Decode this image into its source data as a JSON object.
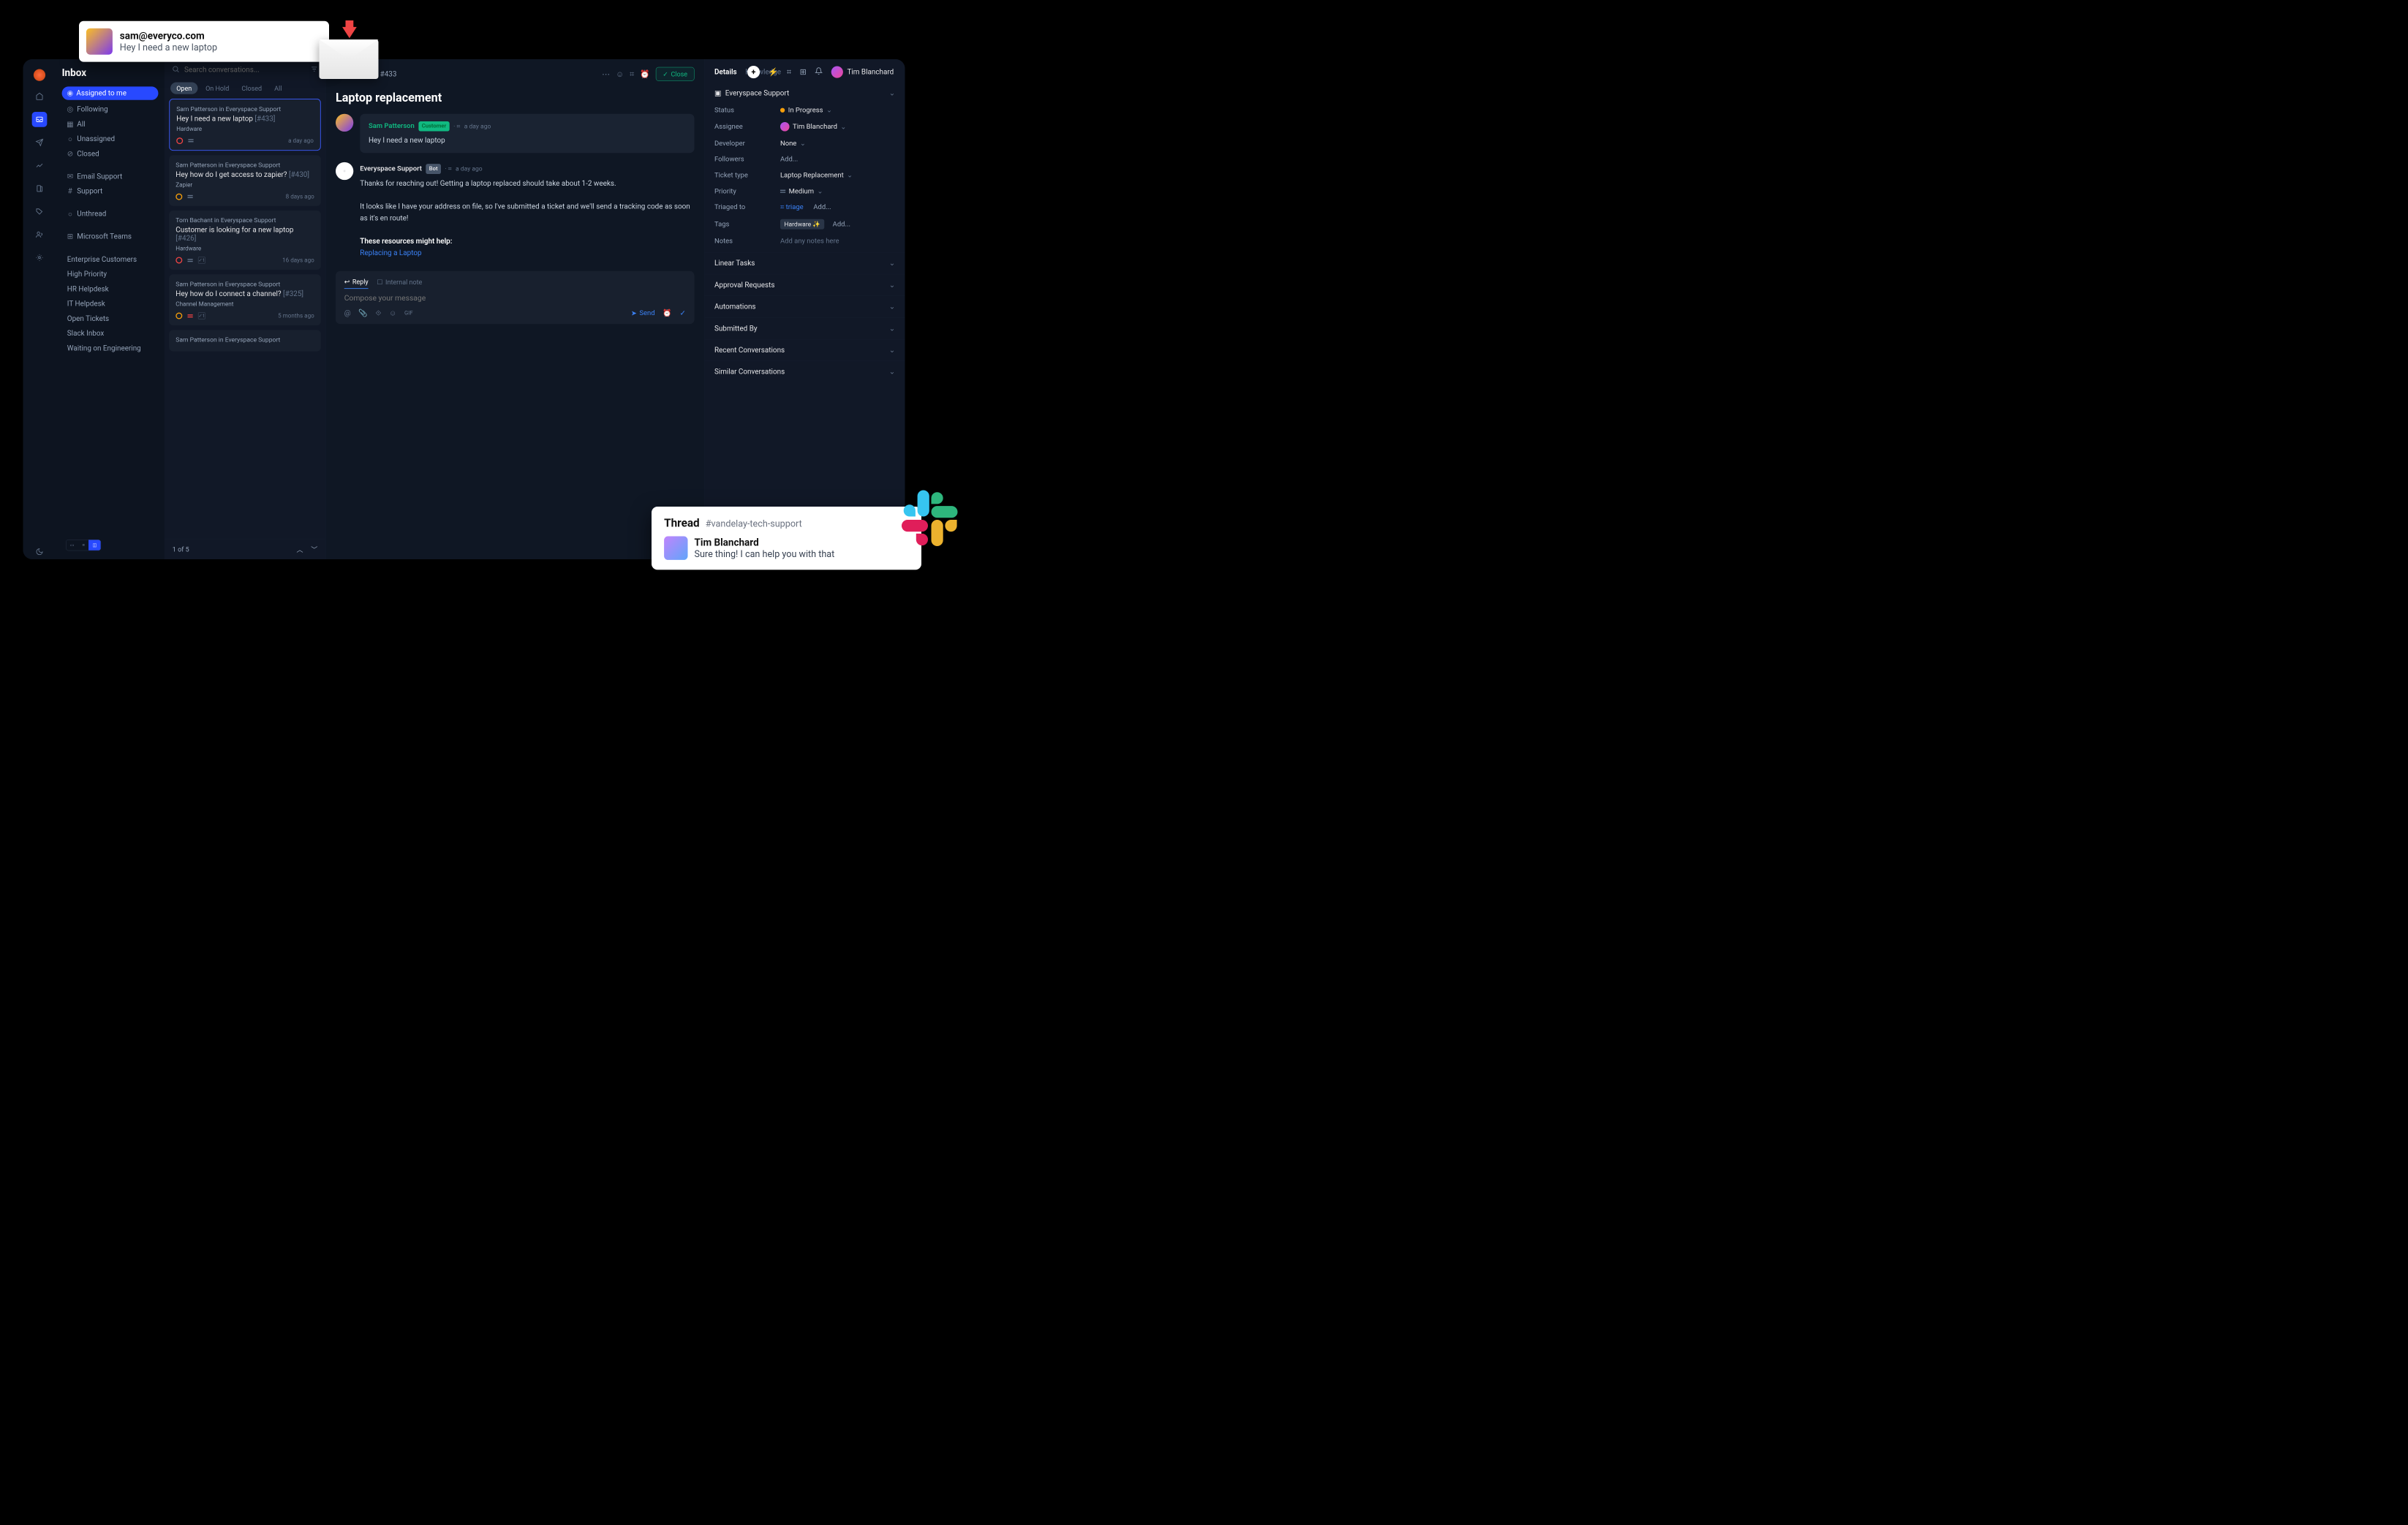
{
  "email_popup": {
    "from": "sam@everyco.com",
    "body": "Hey I need a new laptop"
  },
  "sidebar": {
    "title": "Inbox",
    "primary": [
      {
        "label": "Assigned to me",
        "active": true
      },
      {
        "label": "Following"
      },
      {
        "label": "All"
      },
      {
        "label": "Unassigned"
      },
      {
        "label": "Closed"
      }
    ],
    "channels": [
      {
        "label": "Email Support"
      },
      {
        "label": "Support"
      }
    ],
    "unthread": "Unthread",
    "teams": "Microsoft Teams",
    "views": [
      "Enterprise Customers",
      "High Priority",
      "HR Helpdesk",
      "IT Helpdesk",
      "Open Tickets",
      "Slack Inbox",
      "Waiting on Engineering"
    ]
  },
  "search_placeholder": "Search conversations...",
  "tabs": {
    "open": "Open",
    "hold": "On Hold",
    "closed": "Closed",
    "all": "All"
  },
  "conversations": [
    {
      "from": "Sam Patterson in Everyspace Support",
      "title": "Hey I need a new laptop",
      "num": "[#433]",
      "tag": "Hardware",
      "time": "a day ago",
      "prio": "red",
      "lines": "grey",
      "check": ""
    },
    {
      "from": "Sam Patterson in Everyspace Support",
      "title": "Hey how do I get access to zapier?",
      "num": "[#430]",
      "tag": "Zapier",
      "time": "8 days ago",
      "prio": "yellow",
      "lines": "grey",
      "check": ""
    },
    {
      "from": "Tom Bachant in Everyspace Support",
      "title": "Customer is looking for a new laptop",
      "num": "[#426]",
      "tag": "Hardware",
      "time": "16 days ago",
      "prio": "red",
      "lines": "grey",
      "check": "1"
    },
    {
      "from": "Sam Patterson in Everyspace Support",
      "title": "Hey how do I connect a channel?",
      "num": "[#325]",
      "tag": "Channel Management",
      "time": "5 months ago",
      "prio": "yellow",
      "lines": "red",
      "check": "1"
    },
    {
      "from": "Sam Patterson in Everyspace Support",
      "title": "",
      "num": "",
      "tag": "",
      "time": "",
      "prio": "",
      "lines": "",
      "check": ""
    }
  ],
  "pager": "1 of 5",
  "conversation": {
    "id": "Conversation #433",
    "close": "Close",
    "subject": "Laptop replacement",
    "msg1": {
      "sender": "Sam Patterson",
      "badge": "Customer",
      "time": "a day ago",
      "body": "Hey I need a new laptop"
    },
    "msg2": {
      "sender": "Everyspace Support",
      "badge": "Bot",
      "time": "a day ago",
      "p1": "Thanks for reaching out! Getting a laptop replaced should take about 1-2 weeks.",
      "p2": "It looks like I have your address on file, so I've submitted a ticket and we'll send a tracking code as soon as it's en route!",
      "p3": "These resources might help:",
      "link": "Replacing a Laptop"
    },
    "composer": {
      "reply": "Reply",
      "note": "Internal note",
      "placeholder": "Compose your message",
      "gif": "GIF",
      "send": "Send"
    }
  },
  "details": {
    "tabs": {
      "details": "Details",
      "knowledge": "Knowledge"
    },
    "workspace": "Everyspace Support",
    "fields": {
      "status": {
        "label": "Status",
        "value": "In Progress"
      },
      "assignee": {
        "label": "Assignee",
        "value": "Tim Blanchard"
      },
      "developer": {
        "label": "Developer",
        "value": "None"
      },
      "followers": {
        "label": "Followers",
        "value": "Add..."
      },
      "ticket_type": {
        "label": "Ticket type",
        "value": "Laptop Replacement"
      },
      "priority": {
        "label": "Priority",
        "value": "Medium"
      },
      "triaged": {
        "label": "Triaged to",
        "value": "triage",
        "add": "Add..."
      },
      "tags": {
        "label": "Tags",
        "value": "Hardware ✨",
        "add": "Add..."
      },
      "notes": {
        "label": "Notes",
        "value": "Add any notes here"
      }
    },
    "sections": [
      "Linear Tasks",
      "Approval Requests",
      "Automations",
      "Submitted By",
      "Recent Conversations",
      "Similar Conversations"
    ]
  },
  "topbar_user": "Tim Blanchard",
  "slack": {
    "title": "Thread",
    "channel": "#vandelay-tech-support",
    "sender": "Tim Blanchard",
    "body": "Sure thing! I can help you with that"
  }
}
